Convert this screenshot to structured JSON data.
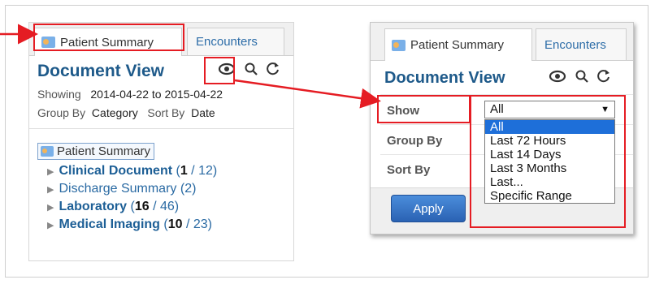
{
  "left": {
    "tabs": [
      "Patient Summary",
      "Encounters"
    ],
    "title": "Document View",
    "showing_label": "Showing",
    "showing_value": "2014-04-22 to 2015-04-22",
    "group_by_label": "Group By",
    "group_by_value": "Category",
    "sort_by_label": "Sort By",
    "sort_by_value": "Date",
    "root_item": "Patient Summary",
    "tree": [
      {
        "label": "Clinical Document",
        "bold": true,
        "count": "1",
        "total": "12"
      },
      {
        "label": "Discharge Summary",
        "bold": false,
        "count": "",
        "total": "2"
      },
      {
        "label": "Laboratory",
        "bold": true,
        "count": "16",
        "total": "46"
      },
      {
        "label": "Medical Imaging",
        "bold": true,
        "count": "10",
        "total": "23"
      }
    ]
  },
  "right": {
    "tabs": [
      "Patient Summary",
      "Encounters"
    ],
    "title": "Document View",
    "show_label": "Show",
    "group_by_label": "Group By",
    "sort_by_label": "Sort By",
    "select_value": "All",
    "options": [
      "All",
      "Last 72 Hours",
      "Last 14 Days",
      "Last 3 Months",
      "Last...",
      "Specific Range"
    ],
    "selected_option": "All",
    "apply_label": "Apply"
  },
  "icons": [
    "eye-icon",
    "search-icon",
    "refresh-icon",
    "patient-summary-icon",
    "expand-arrow-icon",
    "dropdown-caret-icon"
  ],
  "colors": {
    "highlight": "#e51c23",
    "title": "#1e5a8a",
    "link": "#2a6aa3",
    "apply": "#2a62b3",
    "selected_option": "#1e6fd9"
  }
}
